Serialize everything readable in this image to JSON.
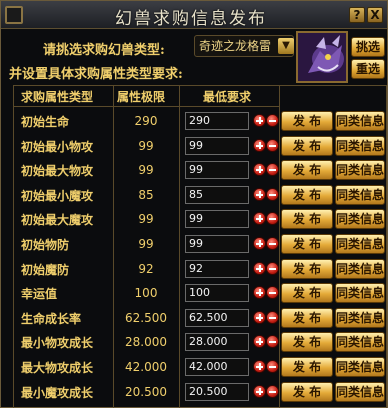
{
  "window": {
    "title": "幻兽求购信息发布"
  },
  "title_buttons": {
    "help": "?",
    "close": "X"
  },
  "select": {
    "label": "请挑选求购幻兽类型:",
    "value": "奇迹之龙格雷"
  },
  "side_buttons": {
    "choose": "挑选",
    "reset": "重选"
  },
  "set_label": "并设置具体求购属性类型要求:",
  "headers": {
    "attr": "求购属性类型",
    "limit": "属性极限",
    "min": "最低要求"
  },
  "row_buttons": {
    "publish": "发 布",
    "same": "同类信息"
  },
  "rows": [
    {
      "name": "初始生命",
      "limit": "290",
      "value": "290"
    },
    {
      "name": "初始最小物攻",
      "limit": "99",
      "value": "99"
    },
    {
      "name": "初始最大物攻",
      "limit": "99",
      "value": "99"
    },
    {
      "name": "初始最小魔攻",
      "limit": "85",
      "value": "85"
    },
    {
      "name": "初始最大魔攻",
      "limit": "99",
      "value": "99"
    },
    {
      "name": "初始物防",
      "limit": "99",
      "value": "99"
    },
    {
      "name": "初始魔防",
      "limit": "92",
      "value": "92"
    },
    {
      "name": "幸运值",
      "limit": "100",
      "value": "100"
    },
    {
      "name": "生命成长率",
      "limit": "62.500",
      "value": "62.500"
    },
    {
      "name": "最小物攻成长",
      "limit": "28.000",
      "value": "28.000"
    },
    {
      "name": "最大物攻成长",
      "limit": "42.000",
      "value": "42.000"
    },
    {
      "name": "最小魔攻成长",
      "limit": "20.500",
      "value": "20.500"
    }
  ]
}
